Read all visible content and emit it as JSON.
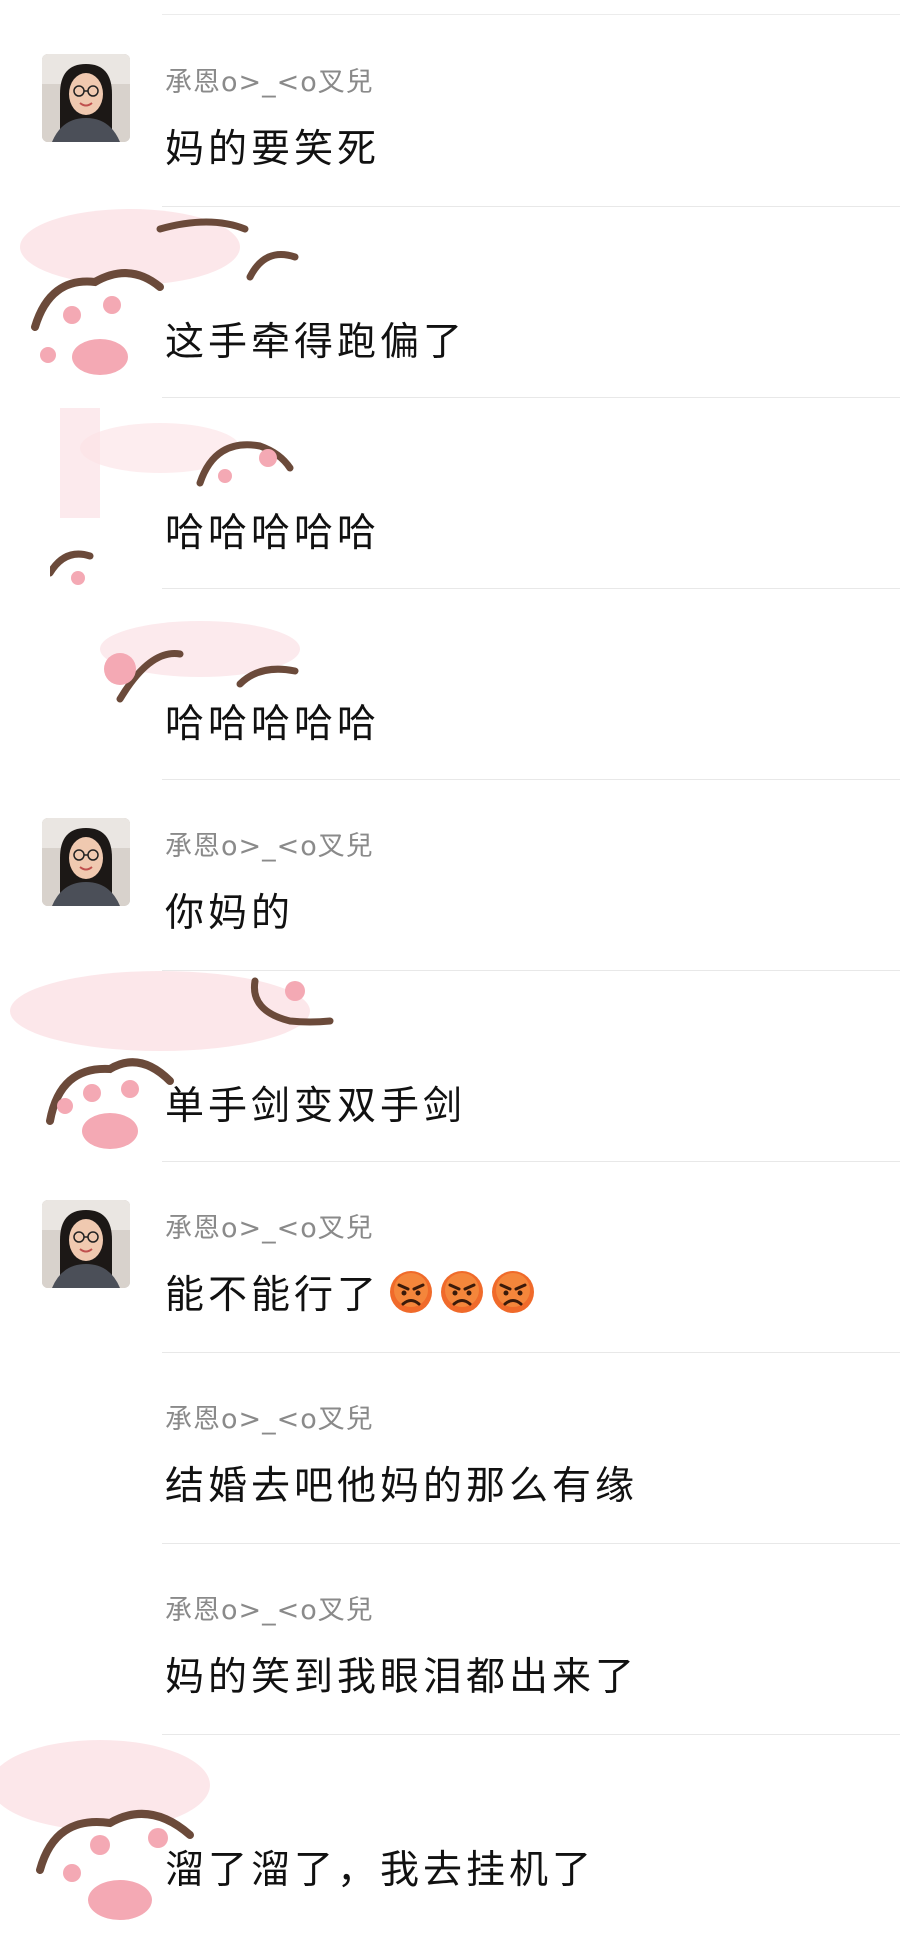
{
  "messages": [
    {
      "sender": "承恩o>_<o叉兒",
      "text": "妈的要笑死",
      "has_avatar": true
    },
    {
      "sender": "",
      "text": "这手牵得跑偏了",
      "has_avatar": false
    },
    {
      "sender": "",
      "text": "哈哈哈哈哈",
      "has_avatar": false
    },
    {
      "sender": "",
      "text": "哈哈哈哈哈",
      "has_avatar": false
    },
    {
      "sender": "承恩o>_<o叉兒",
      "text": "你妈的",
      "has_avatar": true
    },
    {
      "sender": "",
      "text": "单手剑变双手剑",
      "has_avatar": false
    },
    {
      "sender": "承恩o>_<o叉兒",
      "text": "能不能行了",
      "has_avatar": true,
      "emojis": [
        "angry-face",
        "angry-face",
        "angry-face"
      ]
    },
    {
      "sender": "承恩o>_<o叉兒",
      "text": "结婚去吧他妈的那么有缘",
      "has_avatar": false
    },
    {
      "sender": "承恩o>_<o叉兒",
      "text": "妈的笑到我眼泪都出来了",
      "has_avatar": false
    },
    {
      "sender": "",
      "text": "溜了溜了，我去挂机了",
      "has_avatar": false
    }
  ],
  "colors": {
    "sender_text": "#8a8a8a",
    "message_text": "#111111",
    "divider": "#e8e8e8",
    "paw_pink": "#f4a9b4",
    "paw_brown": "#6b4a3a"
  },
  "stickers": [
    "cat-paw-sticker"
  ]
}
